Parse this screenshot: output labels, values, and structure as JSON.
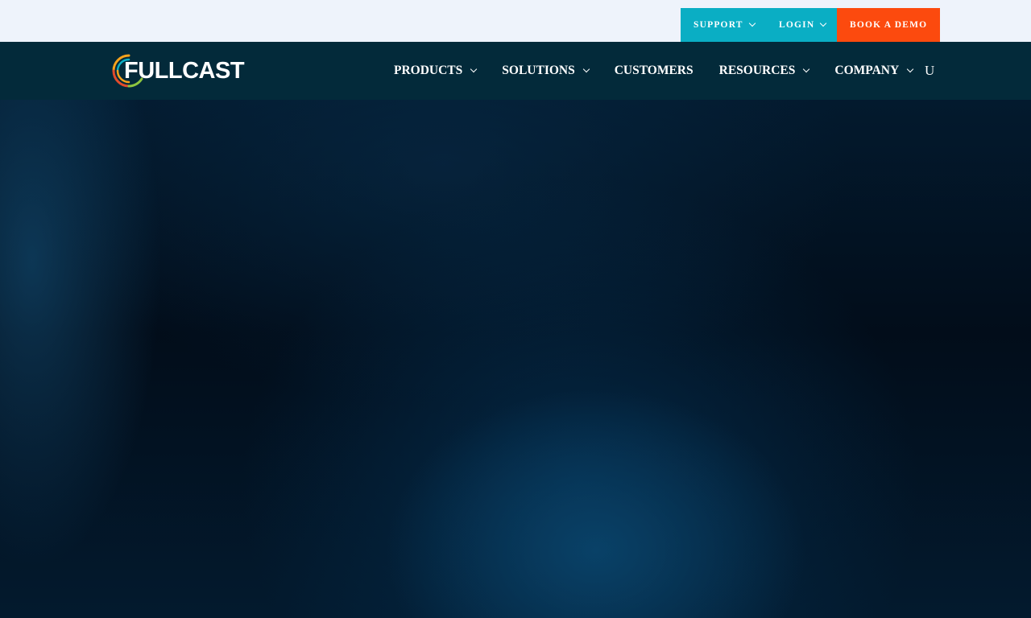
{
  "utility_nav": {
    "support_label": "SUPPORT",
    "login_label": "LOGIN",
    "demo_label": "BOOK A DEMO"
  },
  "brand": {
    "name": "FULLCAST"
  },
  "main_nav": {
    "items": [
      {
        "label": "PRODUCTS",
        "has_dropdown": true
      },
      {
        "label": "SOLUTIONS",
        "has_dropdown": true
      },
      {
        "label": "CUSTOMERS",
        "has_dropdown": false
      },
      {
        "label": "RESOURCES",
        "has_dropdown": true
      },
      {
        "label": "COMPANY",
        "has_dropdown": true
      }
    ],
    "extra_label": "U"
  },
  "colors": {
    "utility_teal": "#0aaec4",
    "demo_orange": "#fc4a0e",
    "nav_bg": "#032a3a",
    "topbar_bg": "#eef3fb"
  },
  "icons": {
    "dropdown": "chevron-down-icon",
    "logo_mark": "fullcast-ring-logo-icon"
  }
}
